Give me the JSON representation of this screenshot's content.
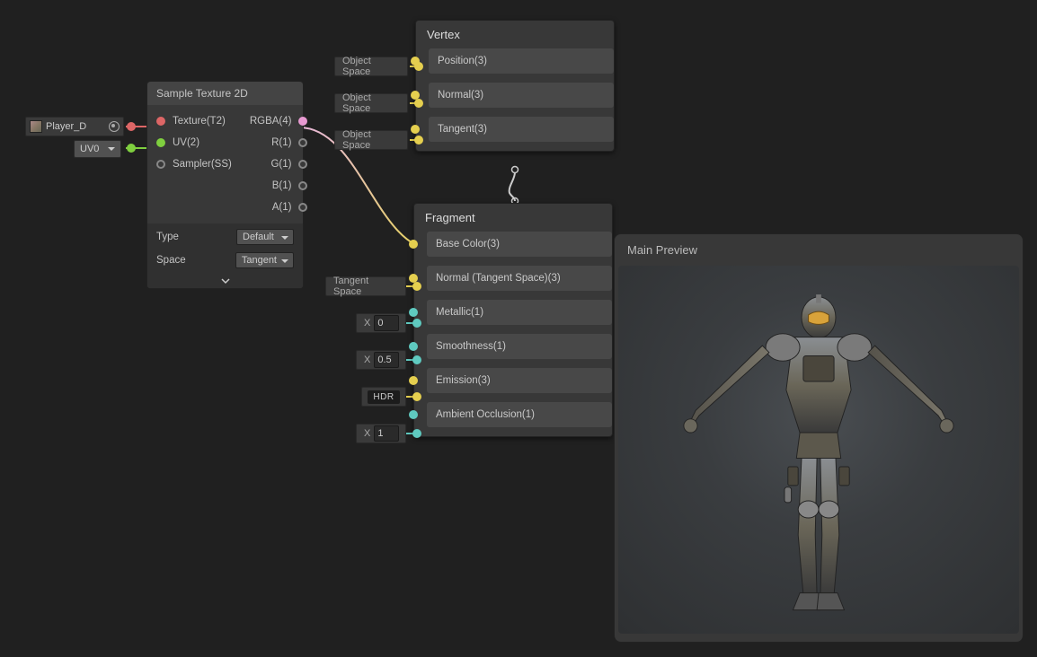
{
  "sample_node": {
    "title": "Sample Texture 2D",
    "inputs": {
      "texture": "Texture(T2)",
      "uv": "UV(2)",
      "sampler": "Sampler(SS)"
    },
    "outputs": {
      "rgba": "RGBA(4)",
      "r": "R(1)",
      "g": "G(1)",
      "b": "B(1)",
      "a": "A(1)"
    },
    "settings": {
      "type_label": "Type",
      "type_value": "Default",
      "space_label": "Space",
      "space_value": "Tangent"
    }
  },
  "asset": {
    "name": "Player_D"
  },
  "uv_dropdown": "UV0",
  "vertex": {
    "title": "Vertex",
    "slots": {
      "position": "Position(3)",
      "normal": "Normal(3)",
      "tangent": "Tangent(3)"
    },
    "tags": {
      "t0": "Object Space",
      "t1": "Object Space",
      "t2": "Object Space"
    }
  },
  "fragment": {
    "title": "Fragment",
    "slots": {
      "base_color": "Base Color(3)",
      "normal_ts": "Normal (Tangent Space)(3)",
      "metallic": "Metallic(1)",
      "smoothness": "Smoothness(1)",
      "emission": "Emission(3)",
      "ao": "Ambient Occlusion(1)"
    },
    "tags": {
      "ts": "Tangent Space",
      "metallic_val": "0",
      "smoothness_val": "0.5",
      "hdr": "HDR",
      "ao_val": "1",
      "x": "X"
    }
  },
  "preview": {
    "title": "Main Preview"
  }
}
